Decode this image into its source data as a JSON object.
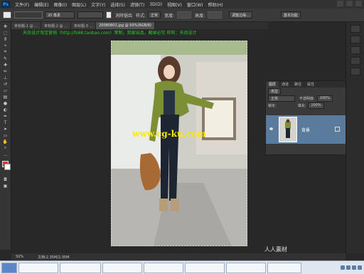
{
  "menubar": {
    "logo": "Ps",
    "items": [
      "文件(F)",
      "编辑(E)",
      "图像(I)",
      "图层(L)",
      "文字(Y)",
      "选择(S)",
      "滤镜(T)",
      "3D(D)",
      "视图(V)",
      "窗口(W)",
      "帮助(H)"
    ]
  },
  "options": {
    "feather": "20 像素",
    "antialias": "消除锯齿",
    "style_label": "样式:",
    "style_value": "正常",
    "width_label": "宽度:",
    "height_label": "高度:",
    "edge_button": "调整边缘...",
    "workspace": "基本功能"
  },
  "tabs": [
    {
      "label": "未标题-1 @ ...",
      "active": false
    },
    {
      "label": "未标题-2 @ ...",
      "active": false
    },
    {
      "label": "未标题-3 ...",
      "active": false
    },
    {
      "label": "20080802.jpg @ 50%(RGB/8)",
      "active": true
    }
  ],
  "banner": "天尚设计淘宝营销（http://fs68.taobao.com）荣制，我家出品，翻录必究  旺旺：天尚设计",
  "canvas_watermark": "www.cg-ku.com",
  "layers_panel": {
    "tabs": [
      "图层",
      "通道",
      "路径",
      "属性"
    ],
    "kind_label": "类型",
    "blend_mode": "正常",
    "opacity_label": "不透明度:",
    "opacity_value": "100%",
    "lock_label": "锁定:",
    "fill_label": "填充:",
    "fill_value": "100%",
    "layer_name": "背景"
  },
  "status": {
    "zoom": "50%",
    "doc": "文档:2.35M/2.35M"
  },
  "bottom_watermark": "人人素材",
  "taskbar": {
    "items": [
      "",
      "",
      "",
      "",
      "",
      "",
      "",
      "",
      ""
    ]
  }
}
